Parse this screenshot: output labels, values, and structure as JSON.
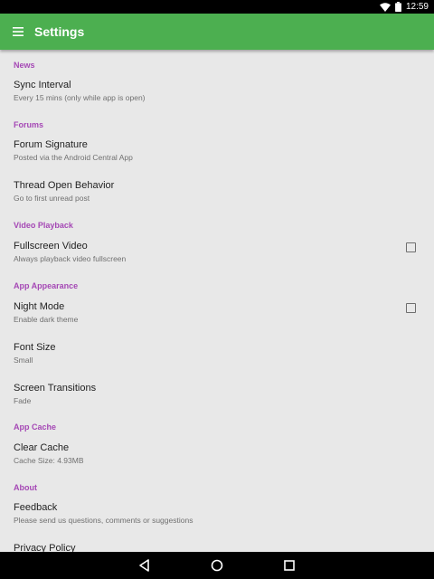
{
  "status_bar": {
    "time": "12:59",
    "icons": [
      "wifi-icon",
      "battery-icon"
    ]
  },
  "app_bar": {
    "title": "Settings",
    "menu_icon": "menu-icon"
  },
  "sections": [
    {
      "header": "News",
      "items": [
        {
          "title": "Sync Interval",
          "summary": "Every 15 mins (only while app is open)"
        }
      ]
    },
    {
      "header": "Forums",
      "items": [
        {
          "title": "Forum Signature",
          "summary": "Posted via the Android Central App"
        },
        {
          "title": "Thread Open Behavior",
          "summary": "Go to first unread post"
        }
      ]
    },
    {
      "header": "Video Playback",
      "items": [
        {
          "title": "Fullscreen Video",
          "summary": "Always playback video fullscreen",
          "checked": false
        }
      ]
    },
    {
      "header": "App Appearance",
      "items": [
        {
          "title": "Night Mode",
          "summary": "Enable dark theme",
          "checked": false
        },
        {
          "title": "Font Size",
          "summary": "Small"
        },
        {
          "title": "Screen Transitions",
          "summary": "Fade"
        }
      ]
    },
    {
      "header": "App Cache",
      "items": [
        {
          "title": "Clear Cache",
          "summary": "Cache Size: 4.93MB"
        }
      ]
    },
    {
      "header": "About",
      "items": [
        {
          "title": "Feedback",
          "summary": "Please send us questions, comments or suggestions"
        },
        {
          "title": "Privacy Policy",
          "summary": ""
        }
      ]
    }
  ],
  "nav_bar": {
    "buttons": [
      "back-icon",
      "home-icon",
      "recents-icon"
    ]
  },
  "colors": {
    "status_bar": "#000000",
    "app_bar": "#4caf50",
    "section_header": "#a548b5",
    "background": "#e8e8e8",
    "title_text": "#222222",
    "summary_text": "#707070",
    "nav_bar": "#000000"
  }
}
